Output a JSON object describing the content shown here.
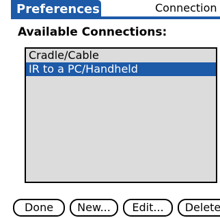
{
  "title": "Preferences",
  "category": "Connection",
  "section_label": "Available Connections:",
  "connections": [
    {
      "label": "Cradle/Cable",
      "selected": false
    },
    {
      "label": "IR to a PC/Handheld",
      "selected": true
    }
  ],
  "buttons": {
    "done": "Done",
    "new": "New...",
    "edit": "Edit...",
    "delete": "Delete"
  },
  "colors": {
    "accent": "#1d5aa8",
    "list_background": "#dcdcdc"
  }
}
